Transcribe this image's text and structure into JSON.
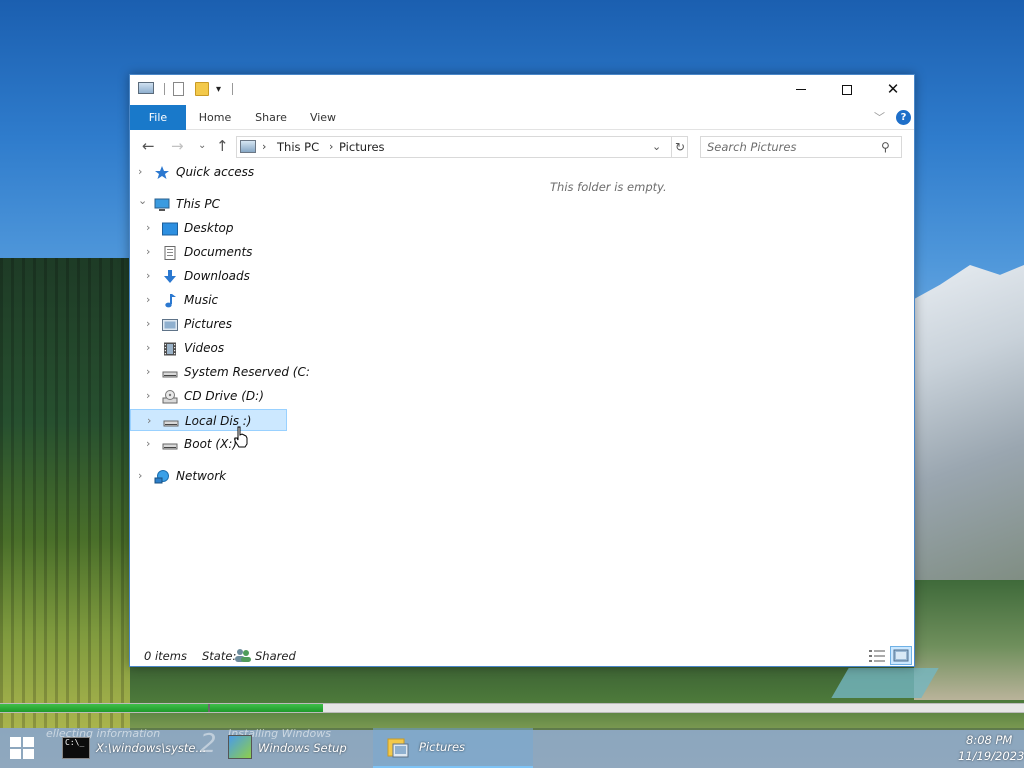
{
  "window": {
    "quick_access_dropdown": "▾",
    "ribbon_tabs": [
      "File",
      "Home",
      "Share",
      "View"
    ],
    "help": "?"
  },
  "navigation": {
    "address_path": [
      "This PC",
      "Pictures"
    ],
    "search_placeholder": "Search Pictures"
  },
  "tree": [
    {
      "label": "Quick access",
      "icon": "star-icon",
      "expanded": false
    },
    {
      "label": "This PC",
      "icon": "computer-icon",
      "expanded": true
    },
    {
      "label": "Desktop",
      "icon": "desktop-icon",
      "expanded": false
    },
    {
      "label": "Documents",
      "icon": "documents-icon",
      "expanded": false
    },
    {
      "label": "Downloads",
      "icon": "download-arrow-icon",
      "expanded": false
    },
    {
      "label": "Music",
      "icon": "music-note-icon",
      "expanded": false
    },
    {
      "label": "Pictures",
      "icon": "pictures-icon",
      "expanded": false
    },
    {
      "label": "Videos",
      "icon": "film-icon",
      "expanded": false
    },
    {
      "label": "System Reserved (C:",
      "icon": "drive-icon",
      "expanded": false
    },
    {
      "label": "CD Drive (D:)",
      "icon": "cd-drive-icon",
      "expanded": false
    },
    {
      "label": "Local Dis :)",
      "icon": "drive-icon",
      "expanded": false,
      "selected": true
    },
    {
      "label": "Boot (X:)",
      "icon": "drive-icon",
      "expanded": false
    },
    {
      "label": "Network",
      "icon": "network-icon",
      "expanded": false
    }
  ],
  "content": {
    "empty_message": "This folder is empty."
  },
  "status": {
    "item_count": "0 items",
    "state_label": "State:",
    "state_value": "Shared"
  },
  "progress": {
    "fill_fraction": 0.315
  },
  "taskbar": {
    "ghost_1": "ellecting information",
    "cmd_label": "X:\\windows\\syste...",
    "ghost_step": "2",
    "ghost_2": "Installing Windows",
    "setup_label": "Windows Setup",
    "active_label": "Pictures",
    "clock_time": "8:08 PM",
    "clock_date": "11/19/2023"
  },
  "colors": {
    "accent": "#1979ca",
    "selection": "#cce8ff",
    "progress": "#2aa834"
  }
}
